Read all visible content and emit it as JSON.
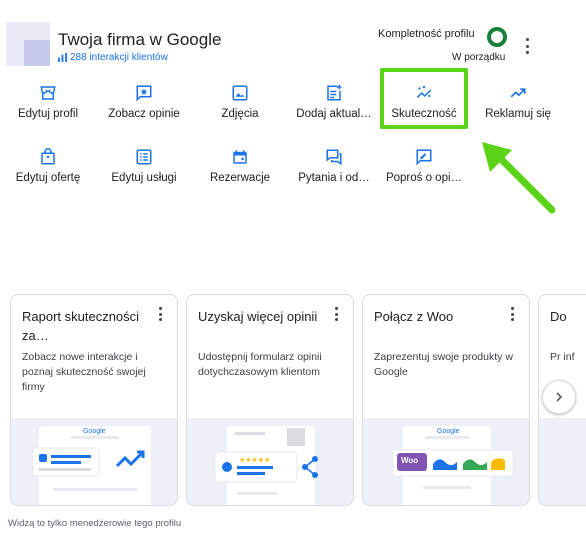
{
  "header": {
    "business_title": "Twoja firma w Google",
    "interactions": "288 interakcji klientów",
    "completeness_label": "Kompletność profilu",
    "completeness_status": "W porządku"
  },
  "actions": [
    {
      "label": "Edytuj profil",
      "icon": "storefront-icon"
    },
    {
      "label": "Zobacz opinie",
      "icon": "star-review-icon"
    },
    {
      "label": "Zdjęcia",
      "icon": "photo-icon"
    },
    {
      "label": "Dodaj aktual…",
      "icon": "post-add-icon"
    },
    {
      "label": "Skuteczność",
      "icon": "performance-icon"
    },
    {
      "label": "Reklamuj się",
      "icon": "trending-up-icon"
    },
    {
      "label": "Edytuj ofertę",
      "icon": "shopping-bag-icon"
    },
    {
      "label": "Edytuj usługi",
      "icon": "services-list-icon"
    },
    {
      "label": "Rezerwacje",
      "icon": "calendar-icon"
    },
    {
      "label": "Pytania i od…",
      "icon": "question-answer-icon"
    },
    {
      "label": "Poproś o opi…",
      "icon": "rate-review-icon"
    }
  ],
  "cards": [
    {
      "title": "Raport skuteczności za…",
      "description": "Zobacz nowe interakcje i poznaj skuteczność swojej firmy",
      "google_label": "Google"
    },
    {
      "title": "Uzyskaj więcej opinii",
      "description": "Udostępnij formularz opinii dotychczasowym klientom",
      "stars": "★★★★★"
    },
    {
      "title": "Połącz z Woo",
      "description": "Zaprezentuj swoje produkty w Google",
      "google_label": "Google",
      "woo_label": "Woo"
    },
    {
      "title": "Do",
      "description": "Pr inf"
    }
  ],
  "footer": {
    "note": "Widzą to tylko menedżerowie tego profilu"
  },
  "colors": {
    "accent_blue": "#1a73e8",
    "progress_green": "#188038",
    "highlight_green": "#5bd417",
    "card_image_bg": "#eef0f7"
  }
}
